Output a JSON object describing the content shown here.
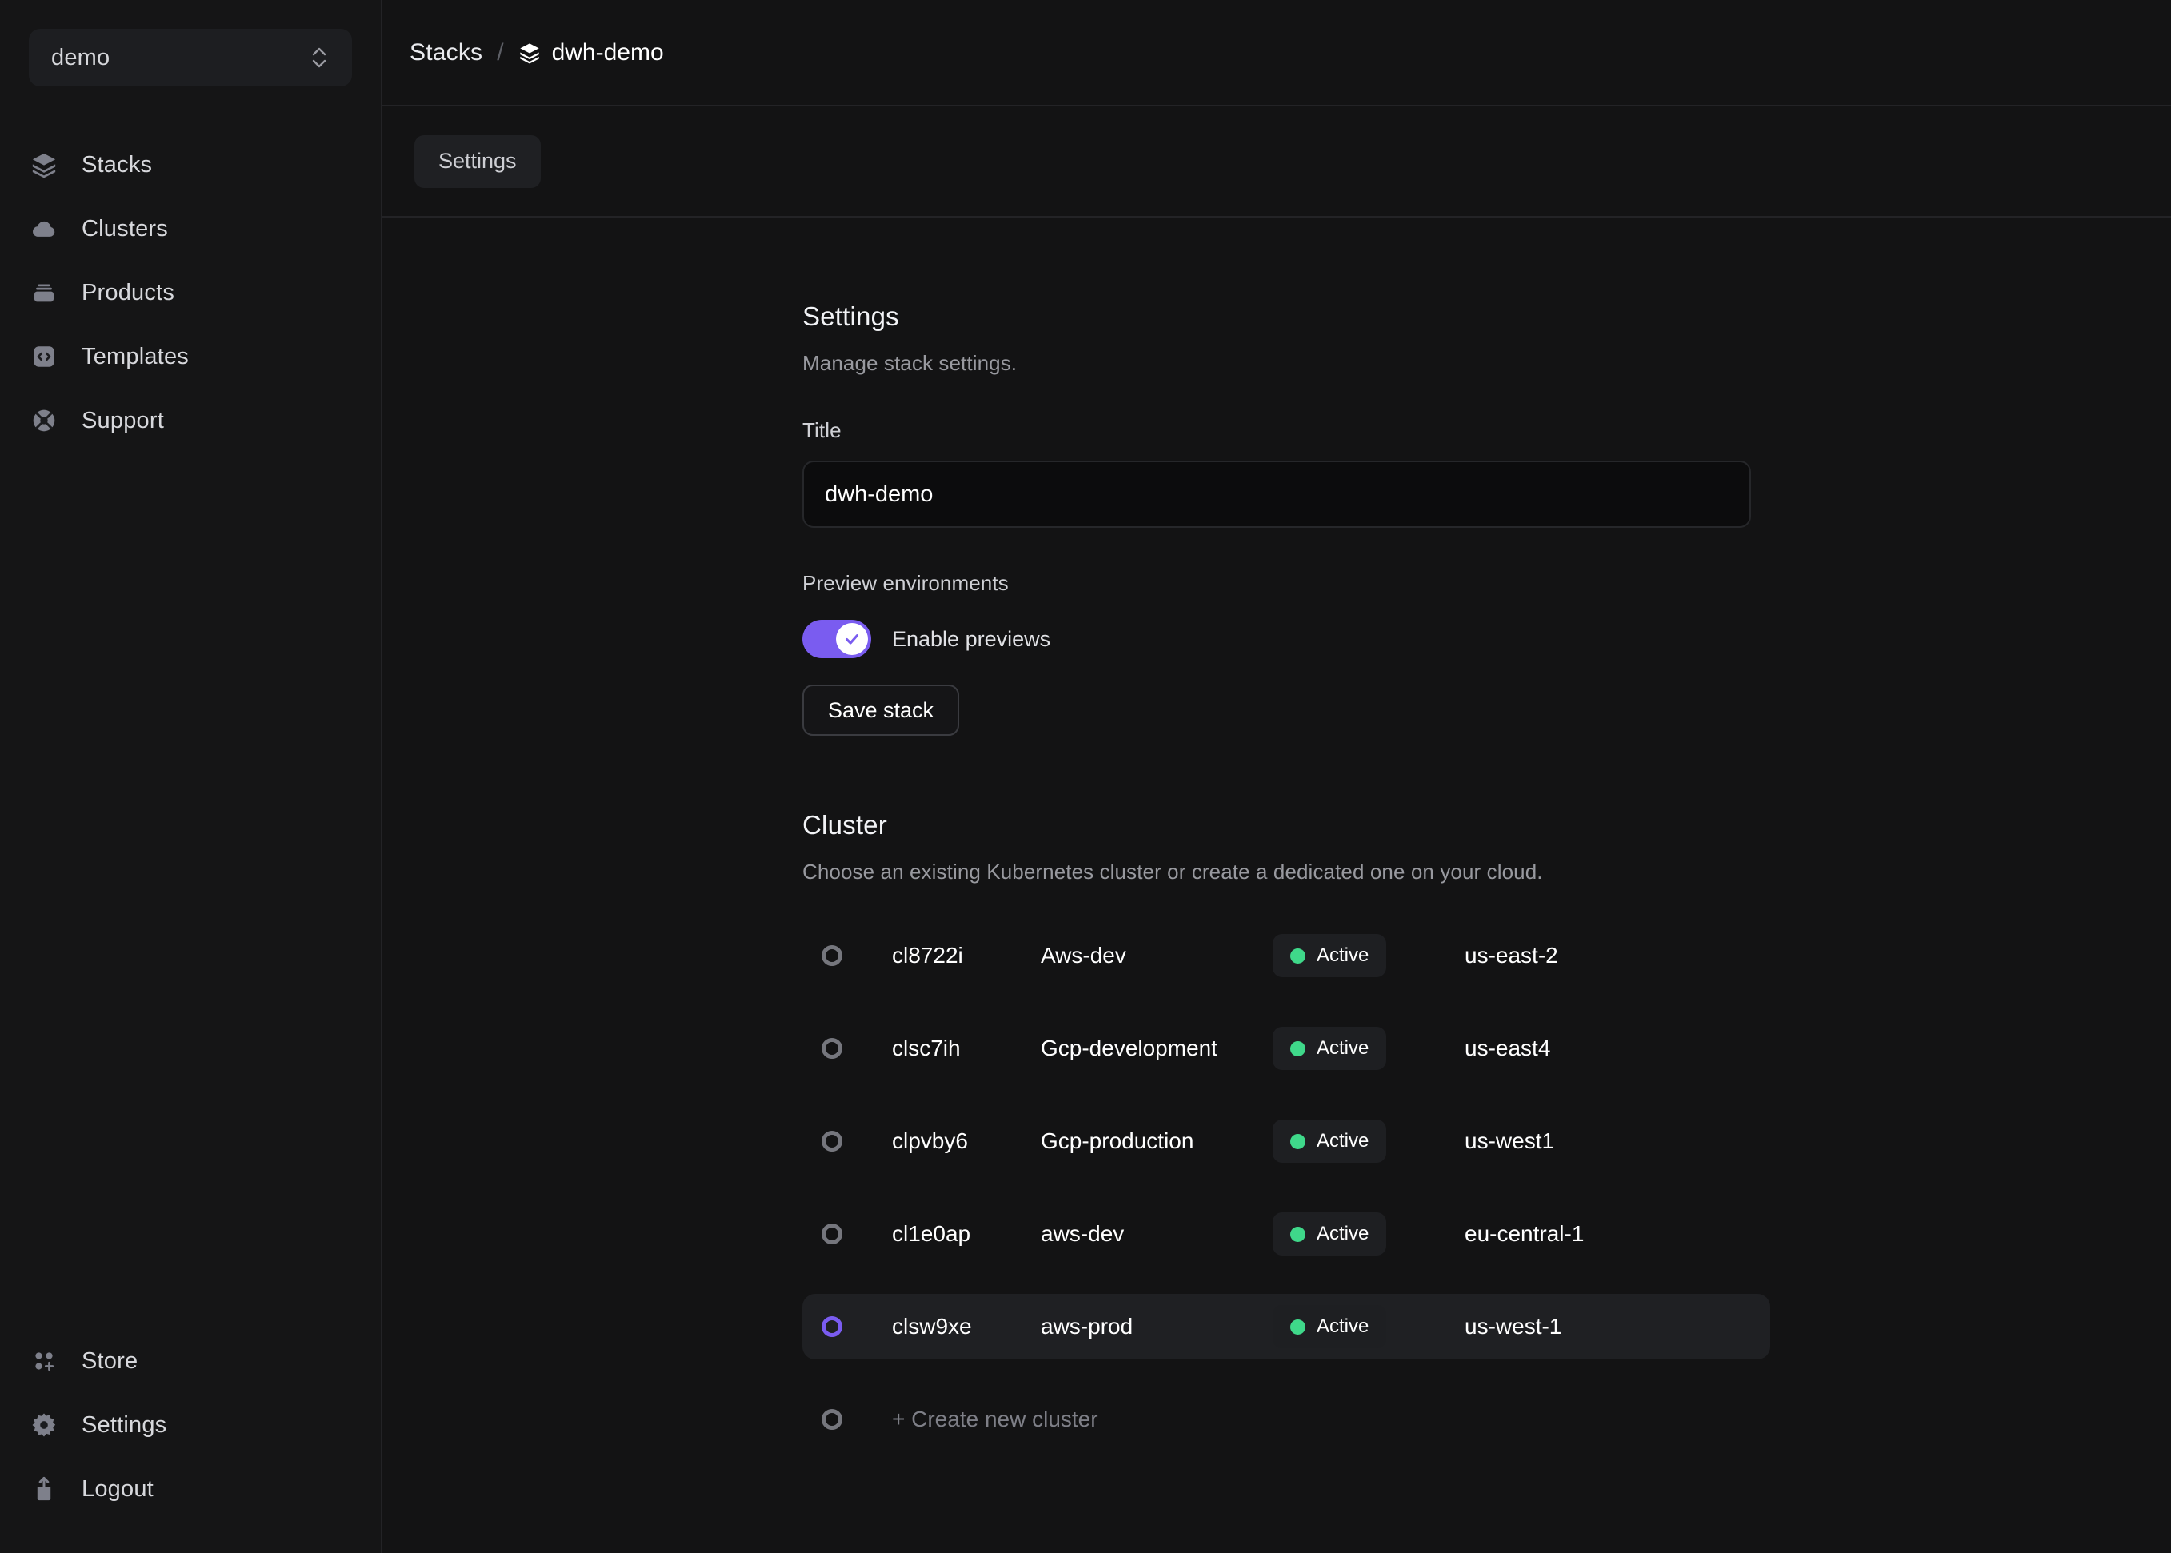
{
  "sidebar": {
    "org": {
      "name": "demo",
      "chevron_icon": "chevron-up-down-icon"
    },
    "nav_top": [
      {
        "label": "Stacks",
        "icon": "layers-icon"
      },
      {
        "label": "Clusters",
        "icon": "cloud-icon"
      },
      {
        "label": "Products",
        "icon": "box-icon"
      },
      {
        "label": "Templates",
        "icon": "code-brackets-icon"
      },
      {
        "label": "Support",
        "icon": "lifebuoy-icon"
      }
    ],
    "nav_bottom": [
      {
        "label": "Store",
        "icon": "grid-plus-icon"
      },
      {
        "label": "Settings",
        "icon": "gear-icon"
      },
      {
        "label": "Logout",
        "icon": "logout-icon"
      }
    ]
  },
  "header": {
    "breadcrumb": {
      "root": "Stacks",
      "separator": "/",
      "current": "dwh-demo",
      "current_icon": "layers-icon"
    },
    "tabs": [
      {
        "label": "Settings",
        "active": true
      }
    ]
  },
  "settings": {
    "title": "Settings",
    "subtitle": "Manage stack settings.",
    "title_field": {
      "label": "Title",
      "value": "dwh-demo",
      "placeholder": "Title"
    },
    "previews": {
      "label": "Preview environments",
      "toggle_label": "Enable previews",
      "enabled": true
    },
    "save_label": "Save stack"
  },
  "cluster": {
    "title": "Cluster",
    "subtitle": "Choose an existing Kubernetes cluster or create a dedicated one on your cloud.",
    "rows": [
      {
        "id": "cl8722i",
        "name": "Aws-dev",
        "status": "Active",
        "region": "us-east-2",
        "selected": false
      },
      {
        "id": "clsc7ih",
        "name": "Gcp-development",
        "status": "Active",
        "region": "us-east4",
        "selected": false
      },
      {
        "id": "clpvby6",
        "name": "Gcp-production",
        "status": "Active",
        "region": "us-west1",
        "selected": false
      },
      {
        "id": "cl1e0ap",
        "name": "aws-dev",
        "status": "Active",
        "region": "eu-central-1",
        "selected": false
      },
      {
        "id": "clsw9xe",
        "name": "aws-prod",
        "status": "Active",
        "region": "us-west-1",
        "selected": true
      }
    ],
    "create_label": "+ Create new cluster"
  },
  "colors": {
    "accent": "#7a5cf0",
    "status_active": "#3fd88a",
    "page_bg": "#131314",
    "sidebar_bg": "#151516"
  }
}
